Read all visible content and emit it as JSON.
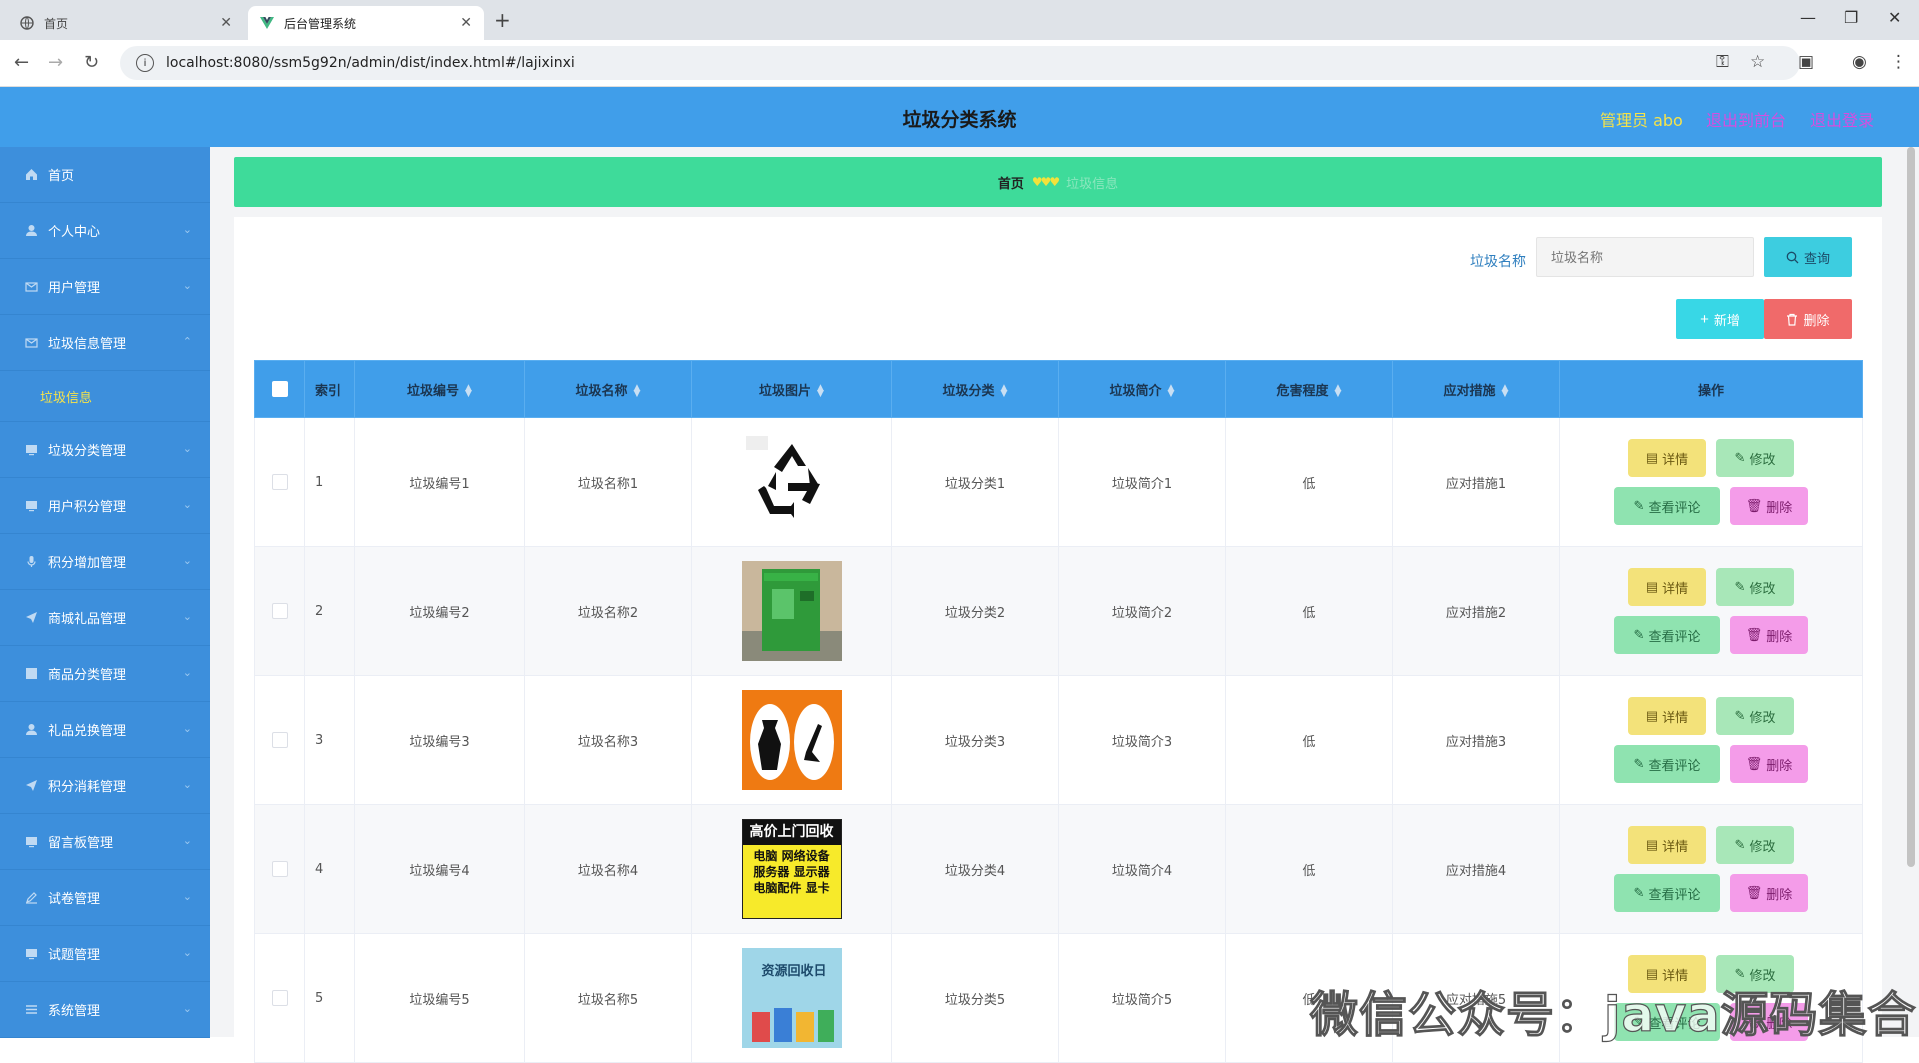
{
  "browser": {
    "tabs": [
      {
        "title": "首页",
        "active": false
      },
      {
        "title": "后台管理系统",
        "active": true
      }
    ],
    "url": "localhost:8080/ssm5g92n/admin/dist/index.html#/lajixinxi"
  },
  "header": {
    "title": "垃圾分类系统",
    "user": "管理员 abo",
    "back_to_front": "退出到前台",
    "logout": "退出登录",
    "user_color": "#f5e34a",
    "link_color": "#d54ee0"
  },
  "sidebar": {
    "items": [
      {
        "label": "首页",
        "icon": "home-icon"
      },
      {
        "label": "个人中心",
        "icon": "user-icon"
      },
      {
        "label": "用户管理",
        "icon": "mail-icon"
      },
      {
        "label": "垃圾信息管理",
        "icon": "mail-icon",
        "expanded": true,
        "sub": "垃圾信息"
      },
      {
        "label": "垃圾分类管理",
        "icon": "monitor-icon"
      },
      {
        "label": "用户积分管理",
        "icon": "monitor-icon"
      },
      {
        "label": "积分增加管理",
        "icon": "microphone-icon"
      },
      {
        "label": "商城礼品管理",
        "icon": "send-icon"
      },
      {
        "label": "商品分类管理",
        "icon": "grid-icon"
      },
      {
        "label": "礼品兑换管理",
        "icon": "user-icon"
      },
      {
        "label": "积分消耗管理",
        "icon": "send-icon"
      },
      {
        "label": "留言板管理",
        "icon": "monitor-icon"
      },
      {
        "label": "试卷管理",
        "icon": "edit-icon"
      },
      {
        "label": "试题管理",
        "icon": "monitor-icon"
      },
      {
        "label": "系统管理",
        "icon": "menu-icon"
      }
    ]
  },
  "breadcrumb": {
    "home": "首页",
    "separator": "♥♥♥",
    "current": "垃圾信息"
  },
  "search": {
    "label": "垃圾名称",
    "placeholder": "垃圾名称",
    "button": "查询"
  },
  "actions": {
    "add": "新增",
    "delete": "删除"
  },
  "table": {
    "columns": [
      "索引",
      "垃圾编号",
      "垃圾名称",
      "垃圾图片",
      "垃圾分类",
      "垃圾简介",
      "危害程度",
      "应对措施",
      "操作"
    ],
    "rows": [
      {
        "index": "1",
        "code": "垃圾编号1",
        "name": "垃圾名称1",
        "image": "recycle-symbol",
        "category": "垃圾分类1",
        "intro": "垃圾简介1",
        "harm": "低",
        "measure": "应对措施1"
      },
      {
        "index": "2",
        "code": "垃圾编号2",
        "name": "垃圾名称2",
        "image": "green-recycling-bin",
        "category": "垃圾分类2",
        "intro": "垃圾简介2",
        "harm": "低",
        "measure": "应对措施2"
      },
      {
        "index": "3",
        "code": "垃圾编号3",
        "name": "垃圾名称3",
        "image": "orange-trash-sign",
        "category": "垃圾分类3",
        "intro": "垃圾简介3",
        "harm": "低",
        "measure": "应对措施3"
      },
      {
        "index": "4",
        "code": "垃圾编号4",
        "name": "垃圾名称4",
        "image": "recycling-ad",
        "image_lines": [
          "高价上门回收",
          "电脑 网络设备",
          "服务器 显示器",
          "电脑配件 显卡"
        ],
        "category": "垃圾分类4",
        "intro": "垃圾简介4",
        "harm": "低",
        "measure": "应对措施4"
      },
      {
        "index": "5",
        "code": "垃圾编号5",
        "name": "垃圾名称5",
        "image": "recycling-day-poster",
        "image_lines": [
          "资源回收日"
        ],
        "category": "垃圾分类5",
        "intro": "垃圾简介5",
        "harm": "低",
        "measure": "应对措施5"
      }
    ],
    "row_buttons": {
      "detail": "详情",
      "edit": "修改",
      "comment": "查看评论",
      "delete": "删除"
    }
  },
  "watermark": "微信公众号：java源码集合"
}
